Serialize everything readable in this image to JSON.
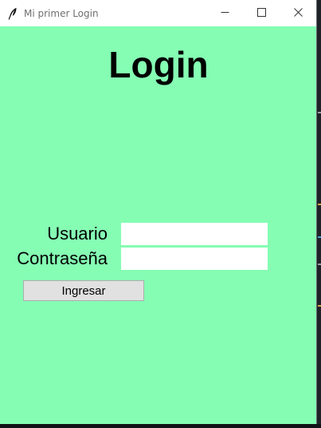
{
  "window": {
    "title": "Mi primer Login",
    "app_icon": "feather-icon",
    "controls": {
      "minimize_icon": "minimize-icon",
      "maximize_icon": "maximize-icon",
      "close_icon": "close-icon"
    },
    "background_color": "#85fdb3"
  },
  "form": {
    "heading": "Login",
    "username_label": "Usuario",
    "username_value": "",
    "password_label": "Contraseña",
    "password_value": "",
    "submit_label": "Ingresar"
  }
}
